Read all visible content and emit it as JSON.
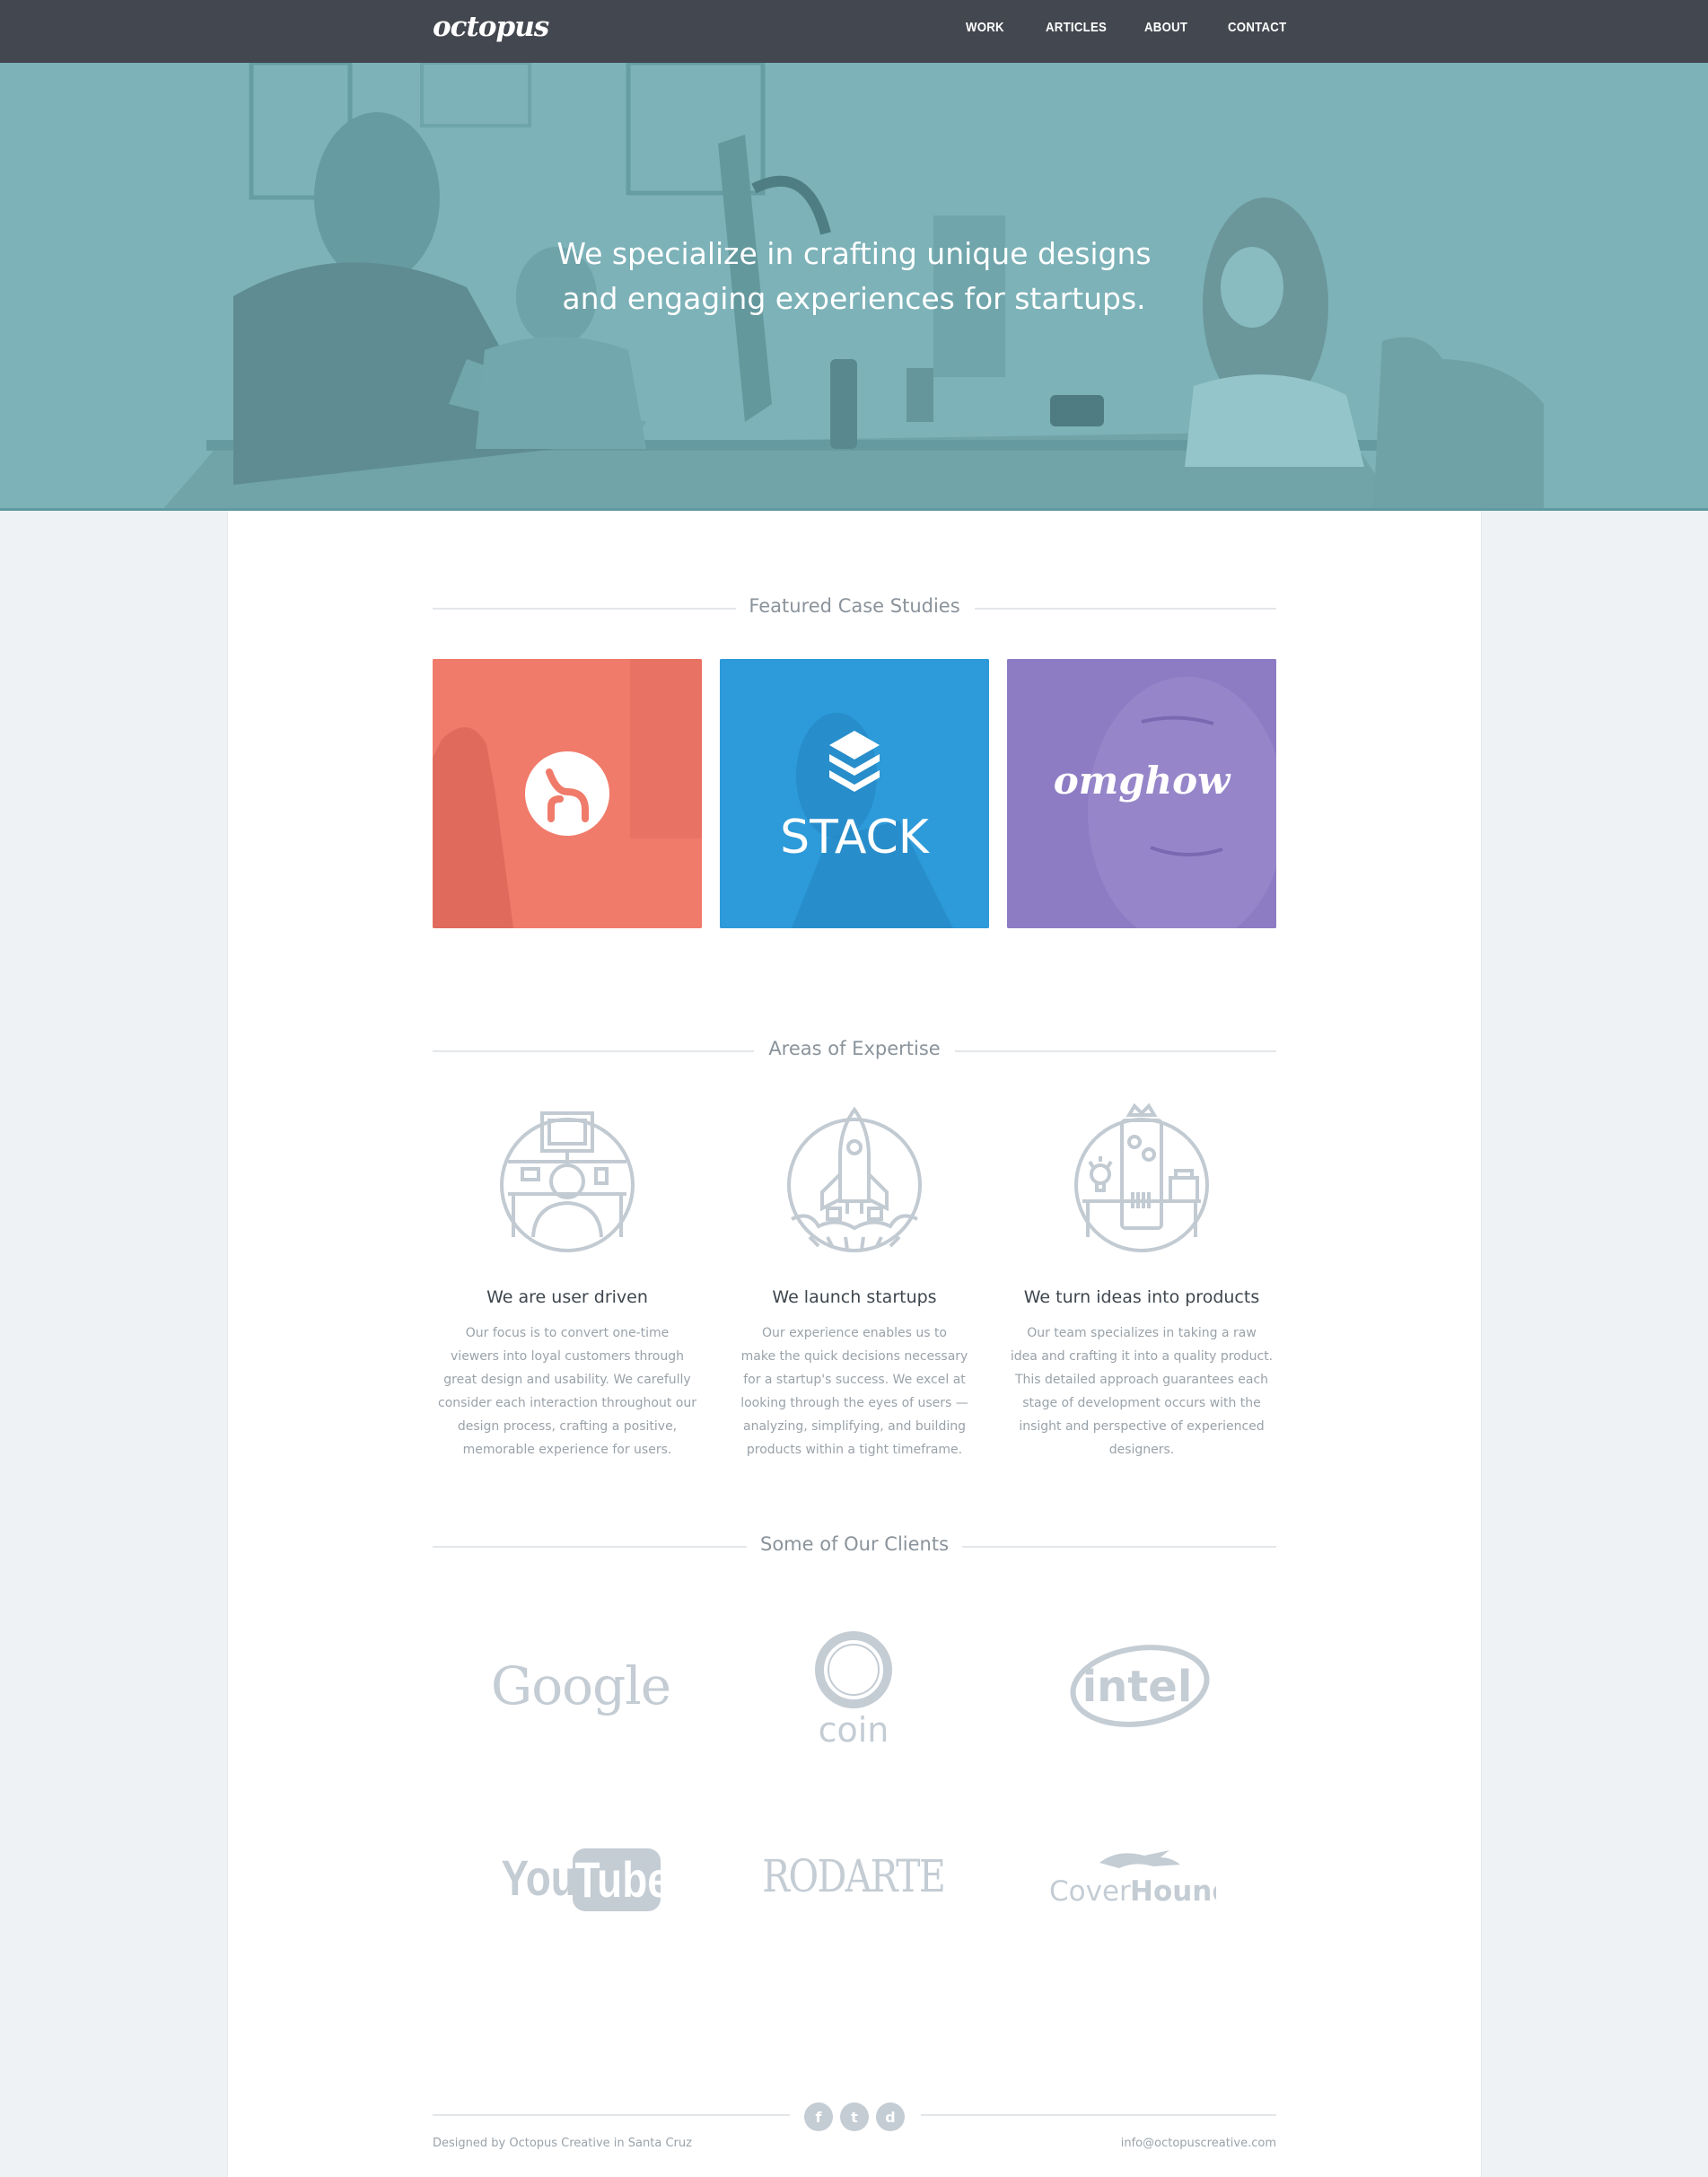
{
  "header": {
    "logo": "octopus",
    "nav": [
      "WORK",
      "ARTICLES",
      "ABOUT",
      "CONTACT"
    ]
  },
  "hero": {
    "line1": "We specialize in crafting unique designs",
    "line2": "and engaging experiences for startups."
  },
  "case_studies": {
    "title": "Featured Case Studies",
    "items": [
      {
        "name": "h",
        "color": "#f07b6a"
      },
      {
        "name": "STACK",
        "color": "#2d9ad9"
      },
      {
        "name": "omghow",
        "color": "#8d7cc4"
      }
    ]
  },
  "expertise": {
    "title": "Areas of Expertise",
    "items": [
      {
        "title": "We are user driven",
        "text": [
          "Our focus is to convert one-time",
          "viewers into loyal customers through",
          "great design and usability. We carefully",
          "consider each interaction throughout our",
          "design process, crafting a positive,",
          "memorable experience for users."
        ],
        "icon": "user-at-desk-icon"
      },
      {
        "title": "We launch startups",
        "text": [
          "Our experience enables us to",
          "make the quick decisions necessary",
          "for a startup's success. We excel at",
          "looking through the eyes of users —",
          "analyzing, simplifying, and building",
          "products within a tight timeframe."
        ],
        "icon": "rocket-icon"
      },
      {
        "title": "We turn ideas into products",
        "text": [
          "Our team specializes in taking a raw",
          "idea and crafting it into a quality product.",
          "This detailed approach guarantees each",
          "stage of development occurs with the",
          "insight and perspective of experienced",
          "designers."
        ],
        "icon": "idea-machine-icon"
      }
    ]
  },
  "clients": {
    "title": "Some of Our Clients",
    "logos": [
      "Google",
      "coin",
      "intel",
      "You",
      "Tube",
      "RODARTE",
      "Cover",
      "Hound"
    ]
  },
  "footer": {
    "social": [
      "f",
      "t",
      "d"
    ],
    "left": "Designed by Octopus Creative in Santa Cruz",
    "right": "info@octopuscreative.com"
  },
  "colors": {
    "topbar": "#43474f",
    "hero": "#79b0b6",
    "coral": "#f07b6a",
    "blue": "#2d9ad9",
    "purple": "#8d7cc4",
    "muted": "#c4ccd4"
  }
}
